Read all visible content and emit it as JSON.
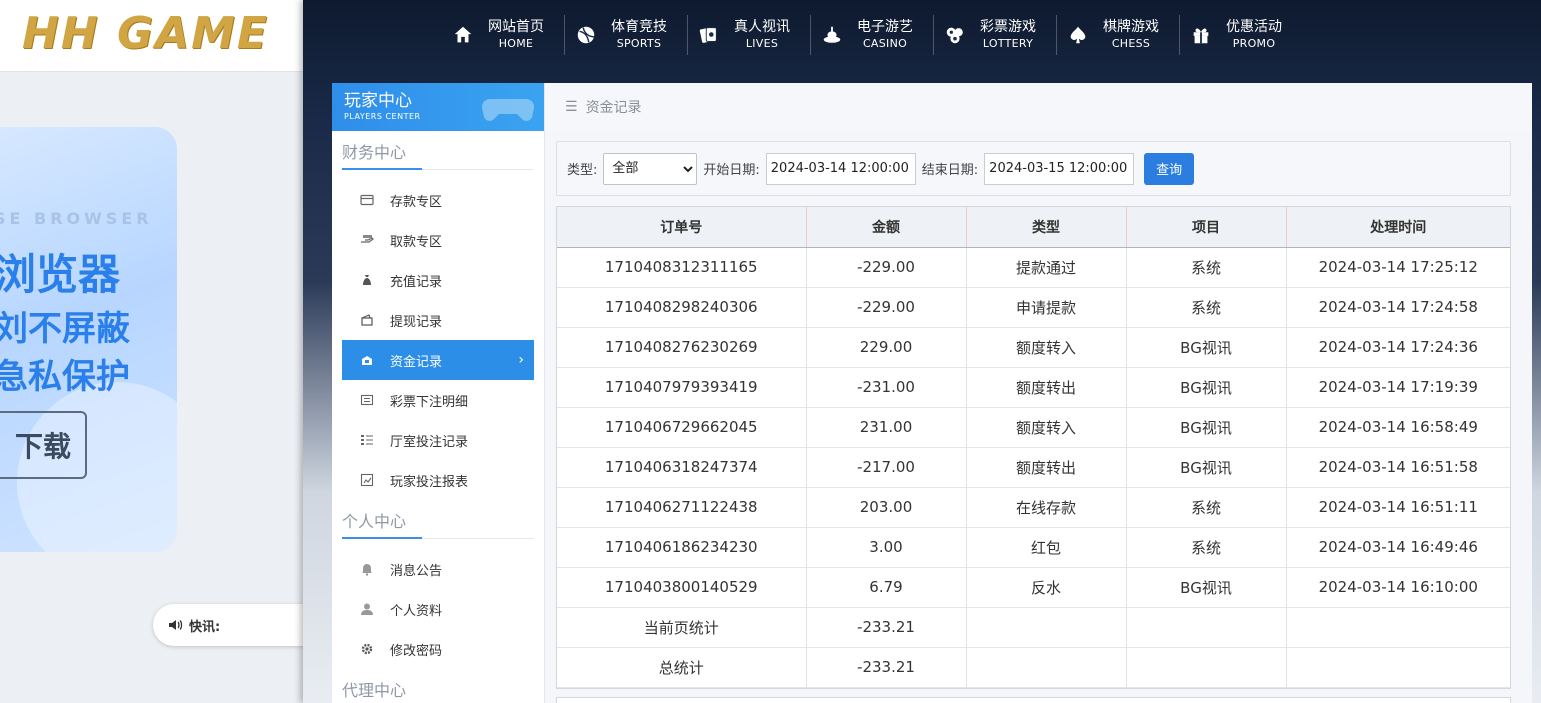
{
  "logo": {
    "text": "HH GAME"
  },
  "promo": {
    "en": "SE BROWSER",
    "line1": "浏览器",
    "line2": "刘不屏蔽",
    "line3": "急私保护",
    "button": "下载"
  },
  "news": {
    "label": "快讯:"
  },
  "nav": [
    {
      "cn": "网站首页",
      "en": "HOME",
      "icon": "home-icon"
    },
    {
      "cn": "体育竞技",
      "en": "SPORTS",
      "icon": "ball-icon"
    },
    {
      "cn": "真人视讯",
      "en": "LIVES",
      "icon": "cards-icon"
    },
    {
      "cn": "电子游艺",
      "en": "CASINO",
      "icon": "slot-icon"
    },
    {
      "cn": "彩票游戏",
      "en": "LOTTERY",
      "icon": "lottery-icon"
    },
    {
      "cn": "棋牌游戏",
      "en": "CHESS",
      "icon": "spade-icon"
    },
    {
      "cn": "优惠活动",
      "en": "PROMO",
      "icon": "gift-icon"
    }
  ],
  "sidebar": {
    "header_title": "玩家中心",
    "header_sub": "PLAYERS CENTER",
    "finance_title": "财务中心",
    "finance_items": [
      "存款专区",
      "取款专区",
      "充值记录",
      "提现记录",
      "资金记录",
      "彩票下注明细",
      "厅室投注记录",
      "玩家投注报表"
    ],
    "personal_title": "个人中心",
    "personal_items": [
      "消息公告",
      "个人资料",
      "修改密码"
    ],
    "agent_title": "代理中心",
    "active_chevron": "›"
  },
  "breadcrumb": "资金记录",
  "filter": {
    "type_label": "类型:",
    "type_value": "全部",
    "start_label": "开始日期:",
    "start_value": "2024-03-14 12:00:00",
    "end_label": "结束日期:",
    "end_value": "2024-03-15 12:00:00",
    "query": "查询"
  },
  "table": {
    "headers": [
      "订单号",
      "金额",
      "类型",
      "项目",
      "处理时间"
    ],
    "rows": [
      [
        "1710408312311165",
        "-229.00",
        "提款通过",
        "系统",
        "2024-03-14 17:25:12"
      ],
      [
        "1710408298240306",
        "-229.00",
        "申请提款",
        "系统",
        "2024-03-14 17:24:58"
      ],
      [
        "1710408276230269",
        "229.00",
        "额度转入",
        "BG视讯",
        "2024-03-14 17:24:36"
      ],
      [
        "1710407979393419",
        "-231.00",
        "额度转出",
        "BG视讯",
        "2024-03-14 17:19:39"
      ],
      [
        "1710406729662045",
        "231.00",
        "额度转入",
        "BG视讯",
        "2024-03-14 16:58:49"
      ],
      [
        "1710406318247374",
        "-217.00",
        "额度转出",
        "BG视讯",
        "2024-03-14 16:51:58"
      ],
      [
        "1710406271122438",
        "203.00",
        "在线存款",
        "系统",
        "2024-03-14 16:51:11"
      ],
      [
        "1710406186234230",
        "3.00",
        "红包",
        "系统",
        "2024-03-14 16:49:46"
      ],
      [
        "1710403800140529",
        "6.79",
        "反水",
        "BG视讯",
        "2024-03-14 16:10:00"
      ]
    ],
    "summary": [
      [
        "当前页统计",
        "-233.21",
        "",
        "",
        ""
      ],
      [
        "总统计",
        "-233.21",
        "",
        "",
        ""
      ]
    ]
  },
  "colors": {
    "accent": "#2d8ee8",
    "nav_bg": "#0e1a2f",
    "logo_gold": "#d1a543"
  }
}
